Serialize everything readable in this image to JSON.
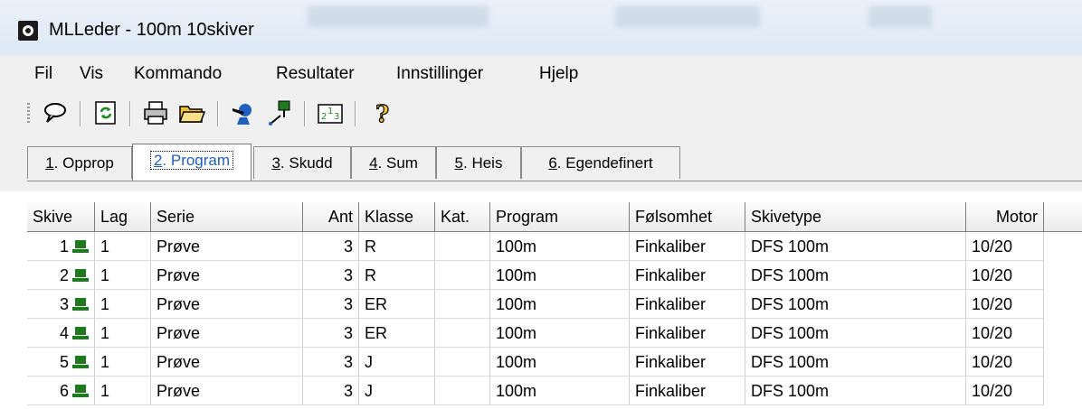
{
  "window": {
    "title": "MLLeder - 100m 10skiver"
  },
  "menu": [
    "Fil",
    "Vis",
    "Kommando",
    "Resultater",
    "Innstillinger",
    "Hjelp"
  ],
  "toolbar": {
    "buttons": [
      "speech-bubble-icon",
      "refresh-icon",
      "print-icon",
      "open-folder-icon",
      "shooter-icon",
      "target-stand-icon",
      "number-chart-icon",
      "help-icon"
    ]
  },
  "tabs": [
    {
      "label": "1. Opprop",
      "accel": "1"
    },
    {
      "label": "2. Program",
      "accel": "2",
      "active": true
    },
    {
      "label": "3. Skudd",
      "accel": "3"
    },
    {
      "label": "4. Sum",
      "accel": "4"
    },
    {
      "label": "5. Heis",
      "accel": "5"
    },
    {
      "label": "6. Egendefinert",
      "accel": "6"
    }
  ],
  "grid": {
    "columns": [
      "Skive",
      "Lag",
      "Serie",
      "Ant",
      "Klasse",
      "Kat.",
      "Program",
      "Følsomhet",
      "Skivetype",
      "Motor"
    ],
    "rows": [
      {
        "skive": "1",
        "lag": "1",
        "serie": "Prøve",
        "ant": "3",
        "klasse": "R",
        "kat": "",
        "program": "100m",
        "folsomhet": "Finkaliber",
        "skivetype": "DFS 100m",
        "motor": "10/20"
      },
      {
        "skive": "2",
        "lag": "1",
        "serie": "Prøve",
        "ant": "3",
        "klasse": "R",
        "kat": "",
        "program": "100m",
        "folsomhet": "Finkaliber",
        "skivetype": "DFS 100m",
        "motor": "10/20"
      },
      {
        "skive": "3",
        "lag": "1",
        "serie": "Prøve",
        "ant": "3",
        "klasse": "ER",
        "kat": "",
        "program": "100m",
        "folsomhet": "Finkaliber",
        "skivetype": "DFS 100m",
        "motor": "10/20"
      },
      {
        "skive": "4",
        "lag": "1",
        "serie": "Prøve",
        "ant": "3",
        "klasse": "ER",
        "kat": "",
        "program": "100m",
        "folsomhet": "Finkaliber",
        "skivetype": "DFS 100m",
        "motor": "10/20"
      },
      {
        "skive": "5",
        "lag": "1",
        "serie": "Prøve",
        "ant": "3",
        "klasse": "J",
        "kat": "",
        "program": "100m",
        "folsomhet": "Finkaliber",
        "skivetype": "DFS 100m",
        "motor": "10/20"
      },
      {
        "skive": "6",
        "lag": "1",
        "serie": "Prøve",
        "ant": "3",
        "klasse": "J",
        "kat": "",
        "program": "100m",
        "folsomhet": "Finkaliber",
        "skivetype": "DFS 100m",
        "motor": "10/20"
      }
    ]
  },
  "colors": {
    "target_icon": "#1f7a1f",
    "active_tab_text": "#1f5fbf"
  }
}
